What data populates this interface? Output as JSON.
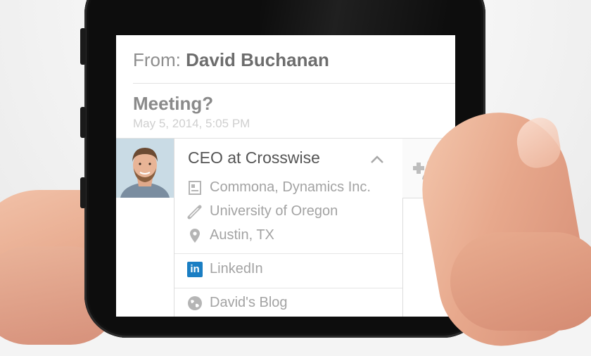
{
  "email": {
    "from_label": "From:",
    "from_name": "David Buchanan",
    "subject": "Meeting?",
    "datetime": "May 5, 2014, 5:05 PM"
  },
  "contact": {
    "title": "CEO at Crosswise",
    "details": [
      {
        "icon": "id-card-icon",
        "text": "Commona, Dynamics Inc."
      },
      {
        "icon": "diploma-icon",
        "text": "University of Oregon"
      },
      {
        "icon": "location-pin-icon",
        "text": "Austin, TX"
      }
    ],
    "links": [
      {
        "icon": "linkedin-icon",
        "text": "LinkedIn"
      },
      {
        "icon": "globe-icon",
        "text": "David's Blog"
      }
    ],
    "linkedin_badge": "in"
  },
  "colors": {
    "linkedin": "#1a7ec3",
    "text_primary": "#6d6d6d",
    "text_secondary": "#a3a3a3"
  }
}
